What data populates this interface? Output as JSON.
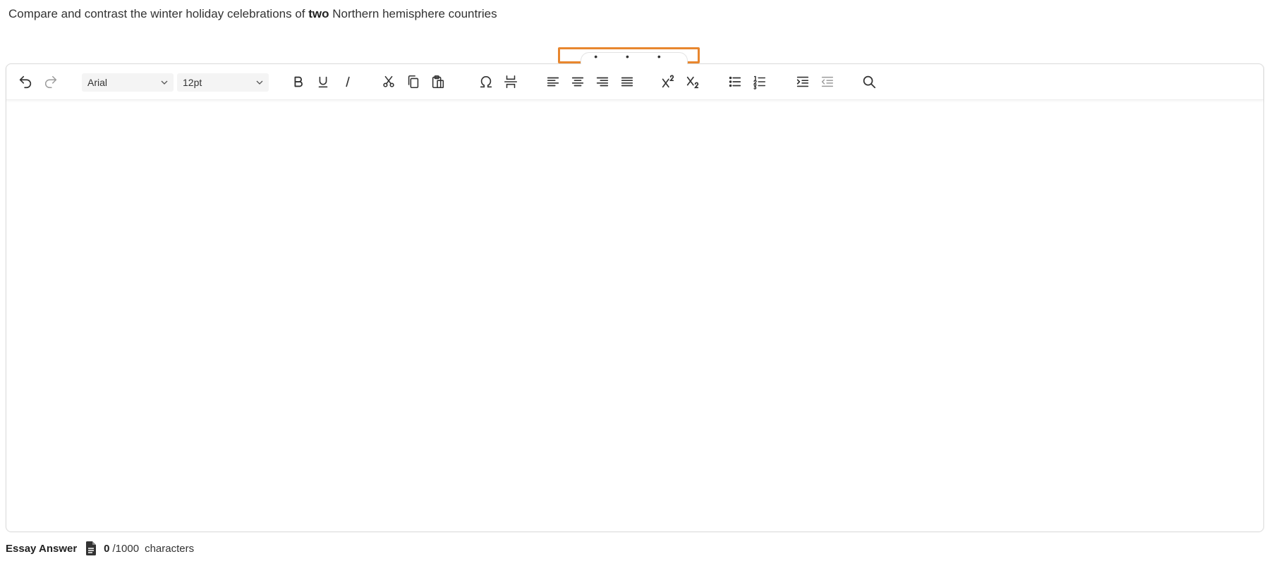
{
  "question": {
    "prefix": "Compare and contrast the winter holiday celebrations of ",
    "emphasis": "two",
    "suffix": " Northern hemisphere countries"
  },
  "toolbar_toggle": {
    "dots": "• • •"
  },
  "toolbar": {
    "font_family": "Arial",
    "font_size": "12pt",
    "icons": [
      "undo-icon",
      "redo-icon",
      "bold-icon",
      "underline-icon",
      "italic-icon",
      "cut-icon",
      "copy-icon",
      "paste-icon",
      "special-character-icon",
      "page-break-icon",
      "align-left-icon",
      "align-center-icon",
      "align-right-icon",
      "justify-icon",
      "superscript-icon",
      "subscript-icon",
      "bullet-list-icon",
      "numbered-list-icon",
      "indent-icon",
      "outdent-icon",
      "search-icon"
    ]
  },
  "footer": {
    "label": "Essay Answer",
    "count": "0",
    "max": "/1000",
    "unit": "characters"
  },
  "colors": {
    "highlight": "#e8862e",
    "text": "#333333",
    "toolbar_select_bg": "#f4f4f4",
    "disabled_icon": "#9a9a9a"
  }
}
